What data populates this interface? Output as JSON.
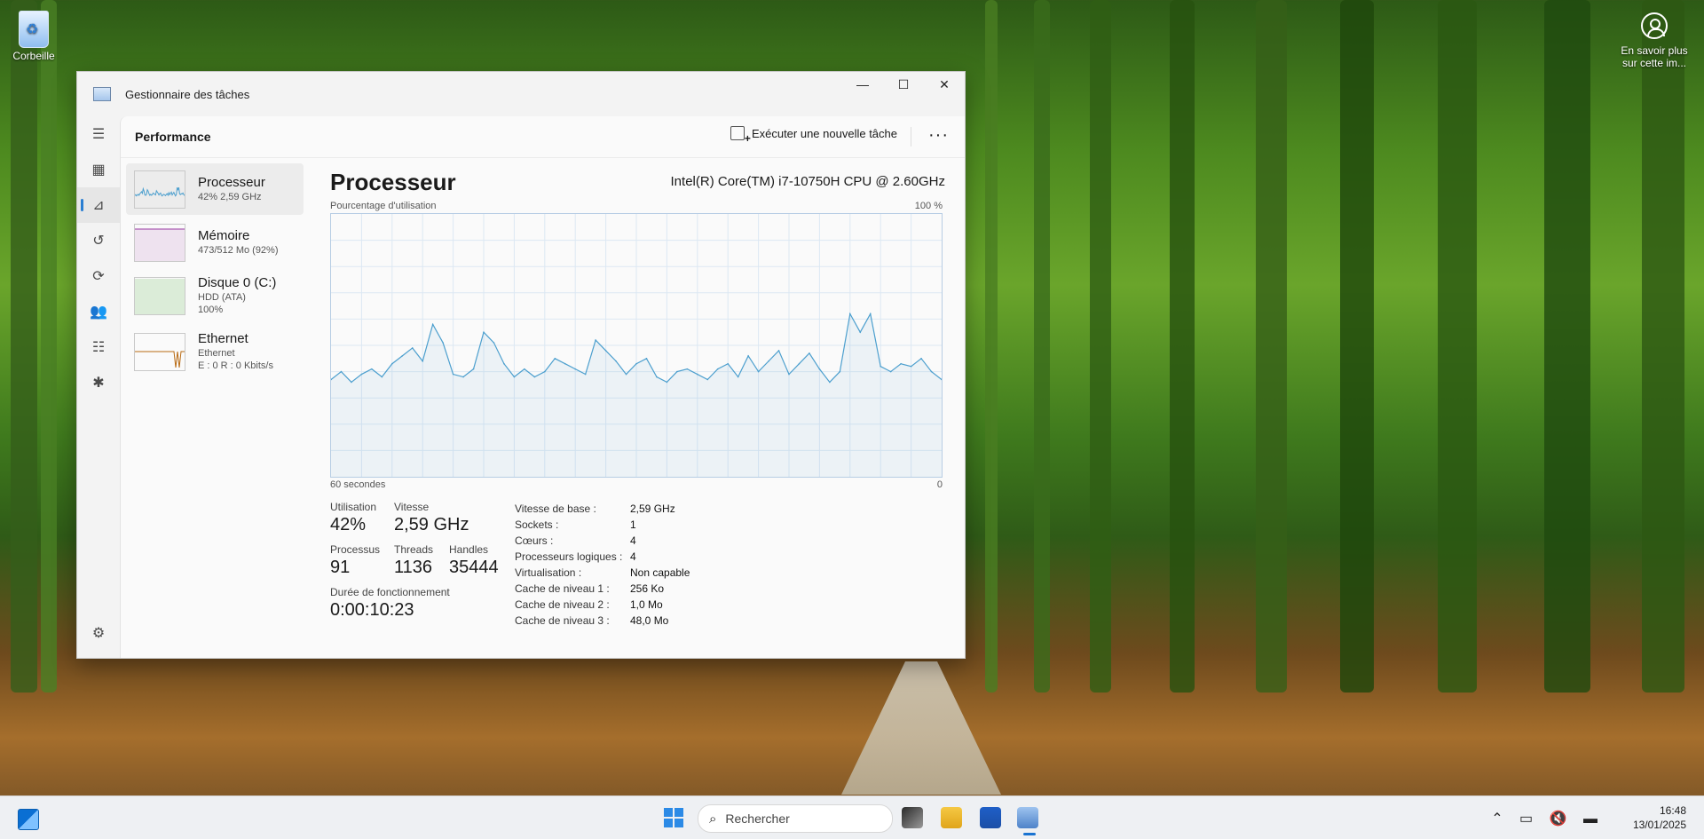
{
  "desktop": {
    "recycle_bin": "Corbeille",
    "learn_more_line1": "En savoir plus",
    "learn_more_line2": "sur cette im..."
  },
  "window": {
    "title": "Gestionnaire des tâches",
    "minimize": "—",
    "maximize": "☐",
    "close": "✕"
  },
  "header": {
    "title": "Performance",
    "run_task": "Exécuter une nouvelle tâche",
    "more": "···"
  },
  "resources": [
    {
      "name": "Processeur",
      "sub1": "42% 2,59 GHz",
      "sub2": "",
      "sub3": ""
    },
    {
      "name": "Mémoire",
      "sub1": "473/512 Mo (92%)",
      "sub2": "",
      "sub3": ""
    },
    {
      "name": "Disque 0 (C:)",
      "sub1": "HDD (ATA)",
      "sub2": "100%",
      "sub3": ""
    },
    {
      "name": "Ethernet",
      "sub1": "Ethernet",
      "sub2": "E : 0 R : 0 Kbits/s",
      "sub3": ""
    }
  ],
  "cpu_panel": {
    "title": "Processeur",
    "cpu_name": "Intel(R) Core(TM) i7-10750H CPU @ 2.60GHz",
    "usage_label": "Pourcentage d'utilisation",
    "max_label": "100 %",
    "time_label": "60 secondes",
    "zero_label": "0",
    "stats": {
      "utilisation_label": "Utilisation",
      "utilisation_value": "42%",
      "speed_label": "Vitesse",
      "speed_value": "2,59 GHz",
      "processes_label": "Processus",
      "processes_value": "91",
      "threads_label": "Threads",
      "threads_value": "1136",
      "handles_label": "Handles",
      "handles_value": "35444",
      "uptime_label": "Durée de fonctionnement",
      "uptime_value": "0:00:10:23"
    },
    "specs": [
      {
        "label": "Vitesse de base :",
        "value": "2,59 GHz"
      },
      {
        "label": "Sockets :",
        "value": "1"
      },
      {
        "label": "Cœurs :",
        "value": "4"
      },
      {
        "label": "Processeurs logiques :",
        "value": "4"
      },
      {
        "label": "Virtualisation :",
        "value": "Non capable"
      },
      {
        "label": "Cache de niveau 1 :",
        "value": "256 Ko"
      },
      {
        "label": "Cache de niveau 2 :",
        "value": "1,0 Mo"
      },
      {
        "label": "Cache de niveau 3 :",
        "value": "48,0 Mo"
      }
    ]
  },
  "chart_data": {
    "type": "area",
    "x": [
      0,
      1,
      2,
      3,
      4,
      5,
      6,
      7,
      8,
      9,
      10,
      11,
      12,
      13,
      14,
      15,
      16,
      17,
      18,
      19,
      20,
      21,
      22,
      23,
      24,
      25,
      26,
      27,
      28,
      29,
      30,
      31,
      32,
      33,
      34,
      35,
      36,
      37,
      38,
      39,
      40,
      41,
      42,
      43,
      44,
      45,
      46,
      47,
      48,
      49,
      50,
      51,
      52,
      53,
      54,
      55,
      56,
      57,
      58,
      59,
      60
    ],
    "values": [
      37,
      40,
      36,
      39,
      41,
      38,
      43,
      46,
      49,
      44,
      58,
      51,
      39,
      38,
      41,
      55,
      51,
      43,
      38,
      41,
      38,
      40,
      45,
      43,
      41,
      39,
      52,
      48,
      44,
      39,
      43,
      45,
      38,
      36,
      40,
      41,
      39,
      37,
      41,
      43,
      38,
      46,
      40,
      44,
      48,
      39,
      43,
      47,
      41,
      36,
      40,
      62,
      55,
      62,
      42,
      40,
      43,
      42,
      45,
      40,
      37
    ],
    "ylim": [
      0,
      100
    ],
    "xlabel": "60 secondes",
    "ylabel": "Pourcentage d'utilisation",
    "grid": true,
    "color": "#4c9fce"
  },
  "thumbs": {
    "cpu_color": "#4c9fce",
    "mem_color": "#9a39a3",
    "disk_color": "#4dac3c",
    "net_color": "#b86a12"
  },
  "taskbar": {
    "search_placeholder": "Rechercher",
    "time": "16:48",
    "date": "13/01/2025"
  }
}
